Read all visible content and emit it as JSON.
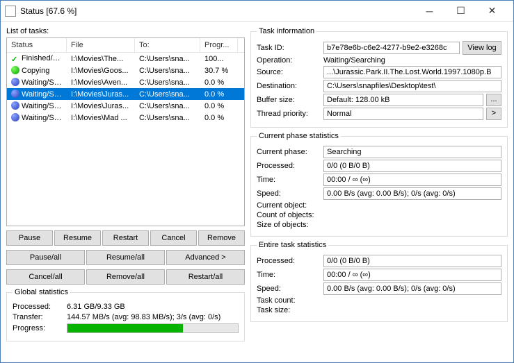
{
  "window": {
    "title": "Status [67.6 %]"
  },
  "list_label": "List of tasks:",
  "columns": {
    "status": "Status",
    "file": "File",
    "to": "To:",
    "progress": "Progr..."
  },
  "tasks": [
    {
      "status": "Finished/C...",
      "file": "I:\\Movies\\The...",
      "to": "C:\\Users\\sna...",
      "progress": "100...",
      "icon": "done",
      "selected": false
    },
    {
      "status": "Copying",
      "file": "I:\\Movies\\Goos...",
      "to": "C:\\Users\\sna...",
      "progress": "30.7 %",
      "icon": "copy",
      "selected": false
    },
    {
      "status": "Waiting/Se...",
      "file": "I:\\Movies\\Aven...",
      "to": "C:\\Users\\sna...",
      "progress": "0.0 %",
      "icon": "wait",
      "selected": false
    },
    {
      "status": "Waiting/Se...",
      "file": "I:\\Movies\\Juras...",
      "to": "C:\\Users\\sna...",
      "progress": "0.0 %",
      "icon": "wait",
      "selected": true
    },
    {
      "status": "Waiting/Se...",
      "file": "I:\\Movies\\Juras...",
      "to": "C:\\Users\\sna...",
      "progress": "0.0 %",
      "icon": "wait",
      "selected": false
    },
    {
      "status": "Waiting/Se...",
      "file": "I:\\Movies\\Mad ...",
      "to": "C:\\Users\\sna...",
      "progress": "0.0 %",
      "icon": "wait",
      "selected": false
    }
  ],
  "buttons": {
    "pause": "Pause",
    "resume": "Resume",
    "restart": "Restart",
    "cancel": "Cancel",
    "remove": "Remove",
    "pause_all": "Pause/all",
    "resume_all": "Resume/all",
    "advanced": "Advanced >",
    "cancel_all": "Cancel/all",
    "remove_all": "Remove/all",
    "restart_all": "Restart/all"
  },
  "global_stats": {
    "legend": "Global statistics",
    "processed_label": "Processed:",
    "processed": "6.31 GB/9.33 GB",
    "transfer_label": "Transfer:",
    "transfer": "144.57 MB/s (avg: 98.83 MB/s); 3/s (avg: 0/s)",
    "progress_label": "Progress:",
    "progress_pct": 67.6
  },
  "task_info": {
    "legend": "Task information",
    "task_id_label": "Task ID:",
    "task_id": "b7e78e6b-c6e2-4277-b9e2-e3268c",
    "view_log": "View log",
    "operation_label": "Operation:",
    "operation": "Waiting/Searching",
    "source_label": "Source:",
    "source": "...\\Jurassic.Park.II.The.Lost.World.1997.1080p.B",
    "destination_label": "Destination:",
    "destination": "C:\\Users\\snapfiles\\Desktop\\test\\",
    "buffer_label": "Buffer size:",
    "buffer": "Default: 128.00 kB",
    "thread_label": "Thread priority:",
    "thread": "Normal",
    "more_btn": "...",
    "gt_btn": ">"
  },
  "current_phase": {
    "legend": "Current phase statistics",
    "phase_label": "Current phase:",
    "phase": "Searching",
    "processed_label": "Processed:",
    "processed": "0/0 (0 B/0 B)",
    "time_label": "Time:",
    "time": "00:00 / ∞ (∞)",
    "speed_label": "Speed:",
    "speed": "0.00 B/s (avg: 0.00 B/s); 0/s (avg: 0/s)",
    "cur_obj_label": "Current object:",
    "count_label": "Count of objects:",
    "size_label": "Size of objects:"
  },
  "entire_task": {
    "legend": "Entire task statistics",
    "processed_label": "Processed:",
    "processed": "0/0 (0 B/0 B)",
    "time_label": "Time:",
    "time": "00:00 / ∞ (∞)",
    "speed_label": "Speed:",
    "speed": "0.00 B/s (avg: 0.00 B/s); 0/s (avg: 0/s)",
    "count_label": "Task count:",
    "size_label": "Task size:"
  }
}
